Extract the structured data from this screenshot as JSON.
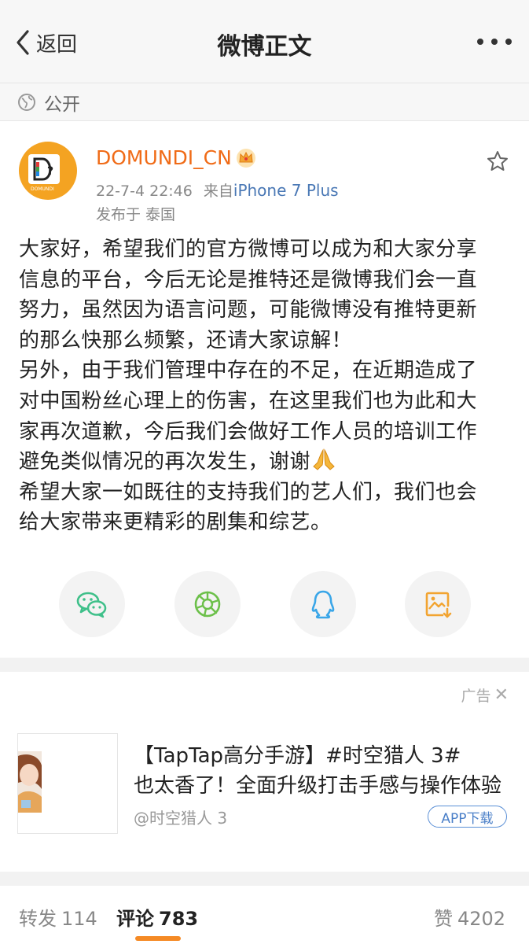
{
  "nav": {
    "back_label": "返回",
    "title": "微博正文"
  },
  "visibility": {
    "label": "公开",
    "icon": "globe-icon"
  },
  "author": {
    "name": "DOMUNDI_CN",
    "badge_icon": "crown-icon",
    "avatar_text": "DOMUNDI",
    "date": "22-7-4 22:46",
    "source_prefix": "来自",
    "device": "iPhone 7 Plus",
    "location": "发布于 泰国"
  },
  "post": {
    "lines": [
      "大家好，希望我们的官方微博可以成为和大家分享",
      "信息的平台，今后无论是推特还是微博我们会一直",
      "努力，虽然因为语言问题，可能微博没有推特更新",
      "的那么快那么频繁，还请大家谅解！",
      "另外，由于我们管理中存在的不足，在近期造成了",
      "对中国粉丝心理上的伤害，在这里我们也为此和大",
      "家再次道歉，今后我们会做好工作人员的培训工作",
      "避免类似情况的再次发生，谢谢",
      "希望大家一如既往的支持我们的艺人们，我们也会",
      "给大家带来更精彩的剧集和综艺。"
    ],
    "emoji": "pray-icon"
  },
  "share": {
    "items": [
      "wechat-icon",
      "moments-icon",
      "qq-icon",
      "save-image-icon"
    ]
  },
  "ad": {
    "close_label": "广告",
    "title_line1": "【TapTap高分手游】#时空猎人 3#",
    "title_line2": "也太香了！全面升级打击手感与操作体验",
    "source": "@时空猎人 3",
    "download_label": "APP下载"
  },
  "tabs": {
    "repost_label": "转发",
    "repost_count": "114",
    "comment_label": "评论",
    "comment_count": "783",
    "like_label": "赞",
    "like_count": "4202"
  },
  "colors": {
    "accent": "#f58a25",
    "username": "#f06b17",
    "link": "#4a78b5",
    "wechat": "#3fc08a",
    "moments": "#6cc04a",
    "qq": "#3aa6e8",
    "save": "#f2a431"
  }
}
